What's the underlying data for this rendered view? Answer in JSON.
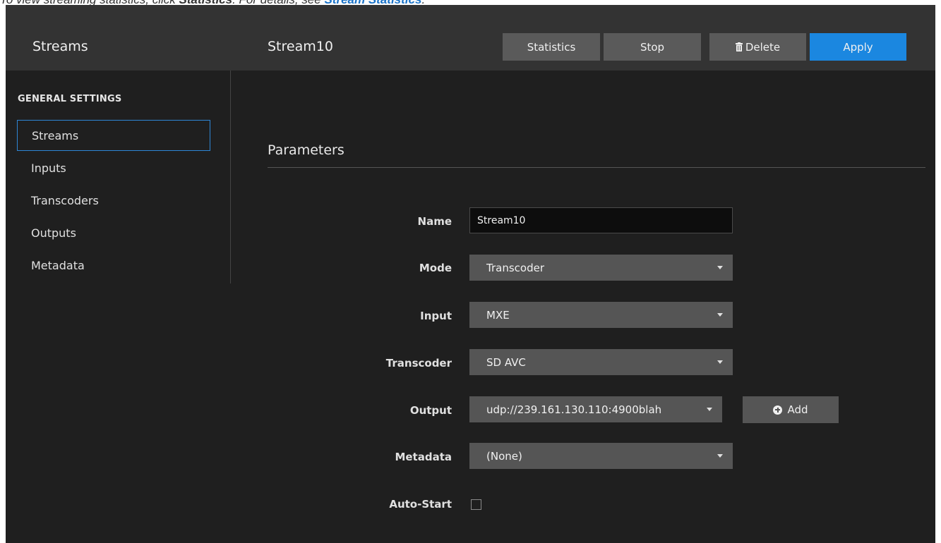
{
  "caption": {
    "prefix": "To view streaming statistics, click ",
    "bold": "Statistics",
    "middle": ". For details, see ",
    "link": "Stream Statistics",
    "suffix": "."
  },
  "header": {
    "section_title": "Streams",
    "stream_title": "Stream10",
    "buttons": {
      "statistics": "Statistics",
      "stop": "Stop",
      "delete": "Delete",
      "apply": "Apply"
    }
  },
  "sidebar": {
    "heading": "GENERAL SETTINGS",
    "items": [
      {
        "label": "Streams",
        "active": true
      },
      {
        "label": "Inputs",
        "active": false
      },
      {
        "label": "Transcoders",
        "active": false
      },
      {
        "label": "Outputs",
        "active": false
      },
      {
        "label": "Metadata",
        "active": false
      }
    ]
  },
  "parameters": {
    "title": "Parameters",
    "name": {
      "label": "Name",
      "value": "Stream10"
    },
    "mode": {
      "label": "Mode",
      "value": "Transcoder"
    },
    "input": {
      "label": "Input",
      "value": "MXE"
    },
    "transcoder": {
      "label": "Transcoder",
      "value": "SD AVC"
    },
    "output": {
      "label": "Output",
      "value": "udp://239.161.130.110:4900blah",
      "add_label": "Add"
    },
    "metadata": {
      "label": "Metadata",
      "value": "(None)"
    },
    "auto_start": {
      "label": "Auto-Start",
      "checked": false
    }
  },
  "colors": {
    "accent": "#1b87e0",
    "background": "#1f1f1f",
    "topbar": "#333333",
    "control": "#555555"
  }
}
